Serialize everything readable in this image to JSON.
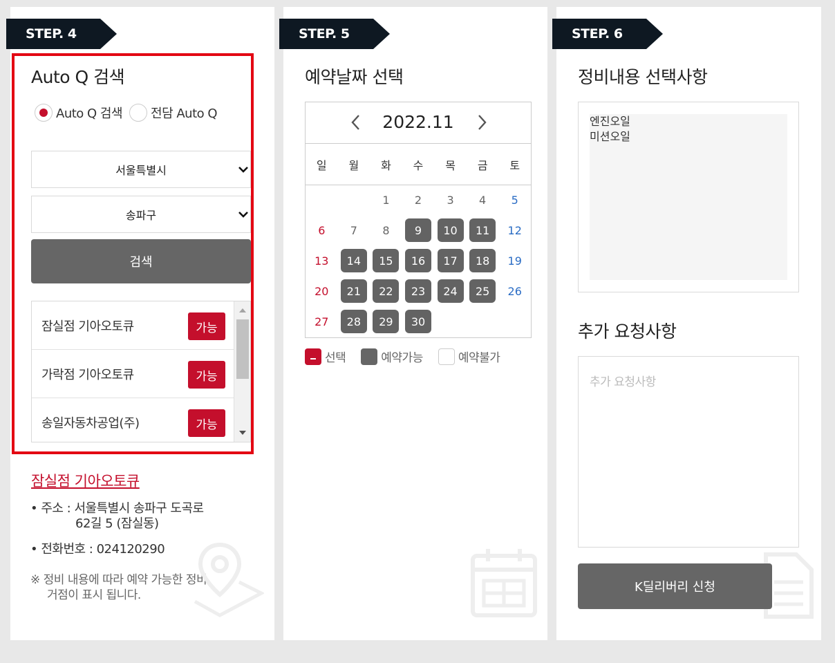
{
  "step4": {
    "step_label": "STEP. 4",
    "title": "Auto Q 검색",
    "radio_options": [
      "Auto Q 검색",
      "전담 Auto Q"
    ],
    "radio_selected": 0,
    "region_select": "서울특별시",
    "district_select": "송파구",
    "search_button": "검색",
    "dealers": [
      {
        "name": "잠실점 기아오토큐",
        "status": "가능"
      },
      {
        "name": "가락점 기아오토큐",
        "status": "가능"
      },
      {
        "name": "송일자동차공업(주)",
        "status": "가능"
      }
    ],
    "selected_dealer": "잠실점 기아오토큐",
    "address_label": "• 주소 : 서울특별시 송파구 도곡로",
    "address_line2": "62길 5 (잠실동)",
    "phone_label": "• 전화번호 : 024120290",
    "note_line1": "※ 정비 내용에 따라 예약 가능한 정비",
    "note_line2": "거점이 표시 됩니다."
  },
  "step5": {
    "step_label": "STEP. 5",
    "title": "예약날짜 선택",
    "calendar": {
      "month": "2022.11",
      "weekdays": [
        "일",
        "월",
        "화",
        "수",
        "목",
        "금",
        "토"
      ],
      "first_weekday": 2,
      "days_in_month": 30,
      "available_days": [
        9,
        10,
        11,
        14,
        15,
        16,
        17,
        18,
        21,
        22,
        23,
        24,
        25,
        28,
        29,
        30
      ]
    },
    "legend": [
      "선택",
      "예약가능",
      "예약불가"
    ]
  },
  "step6": {
    "step_label": "STEP. 6",
    "title": "정비내용 선택사항",
    "selected_items": [
      "엔진오일",
      "미션오일"
    ],
    "extra_title": "추가 요청사항",
    "extra_placeholder": "추가 요청사항",
    "submit_button": "K딜리버리 신청"
  },
  "colors": {
    "brand_red": "#c40f2c",
    "highlight_red": "#e30613",
    "step_bg": "#0e1822",
    "button_gray": "#666666",
    "saturday_blue": "#2a6cc4"
  }
}
